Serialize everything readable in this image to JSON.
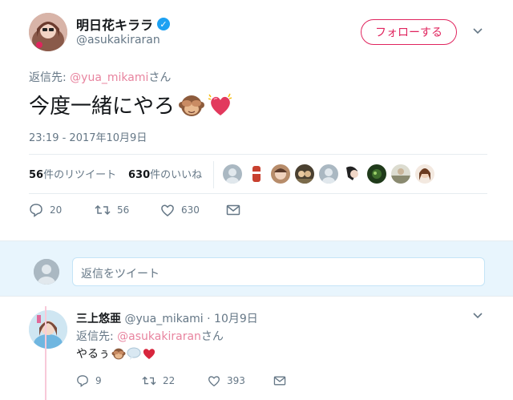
{
  "main_tweet": {
    "display_name": "明日花キララ",
    "handle": "@asukakiraran",
    "follow_label": "フォローする",
    "reply_prefix": "返信先: ",
    "reply_mention": "@yua_mikami",
    "reply_suffix": "さん",
    "text": "今度一緒にやろ",
    "timestamp": "23:19 - 2017年10月9日",
    "retweets_count": "56",
    "retweets_label": "件のリツイート",
    "likes_count": "630",
    "likes_label": "件のいいね",
    "reply_action_count": "20",
    "retweet_action_count": "56",
    "like_action_count": "630"
  },
  "reply_box": {
    "placeholder": "返信をツイート"
  },
  "reply_tweet": {
    "display_name": "三上悠亜",
    "handle": "@yua_mikami",
    "date": " · 10月9日",
    "reply_prefix": "返信先: ",
    "reply_mention": "@asukakiraran",
    "reply_suffix": "さん",
    "text": "やるぅ",
    "reply_action_count": "9",
    "retweet_action_count": "22",
    "like_action_count": "393"
  },
  "icons": [
    "verified-badge-icon",
    "chevron-down-icon",
    "reply-icon",
    "retweet-icon",
    "heart-icon",
    "dm-envelope-icon",
    "see-no-evil-monkey-emoji",
    "sparkling-heart-emoji",
    "speech-balloon-emoji",
    "red-heart-emoji"
  ],
  "colors": {
    "accent_pink": "#e0245e",
    "mention_pink": "#e8849f",
    "muted": "#657786",
    "reply_bar_bg": "#e8f5fd",
    "verified_blue": "#1da1f2"
  }
}
